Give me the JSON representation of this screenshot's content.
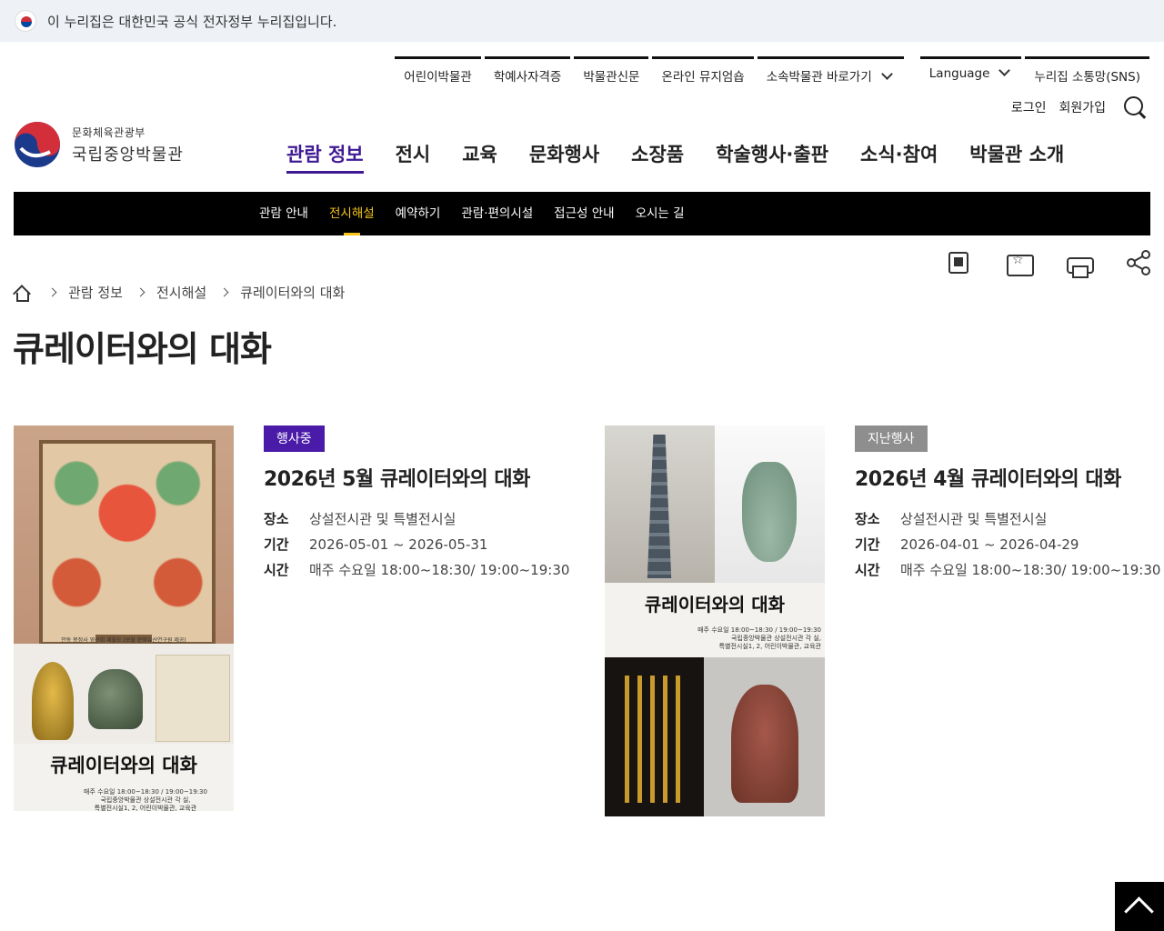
{
  "gov_banner": {
    "text": "이 누리집은 대한민국 공식 전자정부 누리집입니다."
  },
  "util_nav": {
    "items": [
      "어린이박물관",
      "학예사자격증",
      "박물관신문",
      "온라인 뮤지엄숍",
      "소속박물관 바로가기"
    ],
    "language": "Language",
    "sns": "누리집 소통망(SNS)"
  },
  "auth": {
    "login": "로그인",
    "join": "회원가입"
  },
  "logo": {
    "ministry": "문화체육관광부",
    "name": "국립중앙박물관"
  },
  "gnb": {
    "items": [
      "관람 정보",
      "전시",
      "교육",
      "문화행사",
      "소장품",
      "학술행사·출판",
      "소식·참여",
      "박물관 소개"
    ],
    "active": "관람 정보"
  },
  "subnav": {
    "items": [
      "관람 안내",
      "전시해설",
      "예약하기",
      "관람·편의시설",
      "접근성 안내",
      "오시는 길"
    ],
    "active": "전시해설"
  },
  "breadcrumb": [
    "관람 정보",
    "전시해설",
    "큐레이터와의 대화"
  ],
  "page": {
    "title": "큐레이터와의 대화"
  },
  "events": [
    {
      "status": "행사중",
      "title": "2026년 5월 큐레이터와의 대화",
      "place_label": "장소",
      "place": "상설전시관 및 특별전시실",
      "period_label": "기간",
      "period": "2026-05-01 ~ 2026-05-31",
      "time_label": "시간",
      "time": "매주 수요일 18:00~18:30/ 19:00~19:30",
      "poster": {
        "title": "큐레이터와의 대화",
        "caption": "안동 봉정사 영산회 괘불도 (보물 문화유산연구원 제공)",
        "line1": "매주 수요일 18:00~18:30 / 19:00~19:30",
        "line2": "국립중앙박물관 상설전시관 각 실,",
        "line3": "특별전시실1, 2, 어린이박물관, 교육관"
      }
    },
    {
      "status": "지난행사",
      "title": "2026년 4월 큐레이터와의 대화",
      "place_label": "장소",
      "place": "상설전시관 및 특별전시실",
      "period_label": "기간",
      "period": "2026-04-01 ~ 2026-04-29",
      "time_label": "시간",
      "time": "매주 수요일 18:00~18:30/ 19:00~19:30",
      "poster": {
        "title": "큐레이터와의 대화",
        "line1": "매주 수요일 18:00~18:30 / 19:00~19:30",
        "line2": "국립중앙박물관 상설전시관 각 실,",
        "line3": "특별전시실1, 2, 어린이박물관, 교육관"
      }
    }
  ],
  "colors": {
    "accent": "#3f1a94",
    "badge_ongoing": "#4a1aa8",
    "badge_past": "#8e8e8e",
    "subnav_active": "#f5c518"
  },
  "icons": [
    "flag-icon",
    "search-icon",
    "qr-icon",
    "favorite-icon",
    "print-icon",
    "share-icon",
    "home-icon",
    "top-arrow-icon"
  ]
}
